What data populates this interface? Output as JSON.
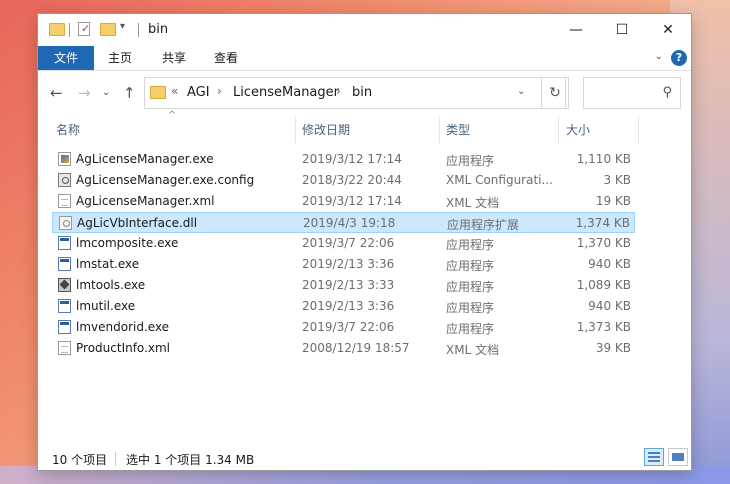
{
  "window": {
    "title": "bin",
    "minimize": "—",
    "maximize": "☐",
    "close": "✕"
  },
  "ribbon": {
    "file_tab": "文件",
    "tabs": [
      "主页",
      "共享",
      "查看"
    ],
    "collapse": "⌄",
    "help": "?"
  },
  "nav": {
    "back": "←",
    "forward": "→",
    "recent": "⌄",
    "up": "↑",
    "overflow": "«",
    "breadcrumbs": [
      "AGI",
      "LicenseManager",
      "bin"
    ],
    "crumb_sep": "›",
    "dropdown": "⌄",
    "refresh": "↻",
    "search_icon": "⚲",
    "search_placeholder": ""
  },
  "columns": {
    "name": "名称",
    "date": "修改日期",
    "type": "类型",
    "size": "大小",
    "sort_indicator": "^"
  },
  "files": [
    {
      "name": "AgLicenseManager.exe",
      "date": "2019/3/12 17:14",
      "type": "应用程序",
      "size": "1,110 KB",
      "icon": "app"
    },
    {
      "name": "AgLicenseManager.exe.config",
      "date": "2018/3/22 20:44",
      "type": "XML Configurati...",
      "size": "3 KB",
      "icon": "cfg"
    },
    {
      "name": "AgLicenseManager.xml",
      "date": "2019/3/12 17:14",
      "type": "XML 文档",
      "size": "19 KB",
      "icon": "doc"
    },
    {
      "name": "AgLicVbInterface.dll",
      "date": "2019/4/3 19:18",
      "type": "应用程序扩展",
      "size": "1,374 KB",
      "icon": "dll",
      "selected": true
    },
    {
      "name": "lmcomposite.exe",
      "date": "2019/3/7 22:06",
      "type": "应用程序",
      "size": "1,370 KB",
      "icon": "exe"
    },
    {
      "name": "lmstat.exe",
      "date": "2019/2/13 3:36",
      "type": "应用程序",
      "size": "940 KB",
      "icon": "exe"
    },
    {
      "name": "lmtools.exe",
      "date": "2019/2/13 3:33",
      "type": "应用程序",
      "size": "1,089 KB",
      "icon": "tool"
    },
    {
      "name": "lmutil.exe",
      "date": "2019/2/13 3:36",
      "type": "应用程序",
      "size": "940 KB",
      "icon": "exe"
    },
    {
      "name": "lmvendorid.exe",
      "date": "2019/3/7 22:06",
      "type": "应用程序",
      "size": "1,373 KB",
      "icon": "exe"
    },
    {
      "name": "ProductInfo.xml",
      "date": "2008/12/19 18:57",
      "type": "XML 文档",
      "size": "39 KB",
      "icon": "doc"
    }
  ],
  "status": {
    "count": "10 个项目",
    "selection": "选中 1 个项目  1.34 MB"
  },
  "colors": {
    "accent": "#1f68b4",
    "selection_bg": "#cce8ff",
    "selection_border": "#99d1ff"
  }
}
